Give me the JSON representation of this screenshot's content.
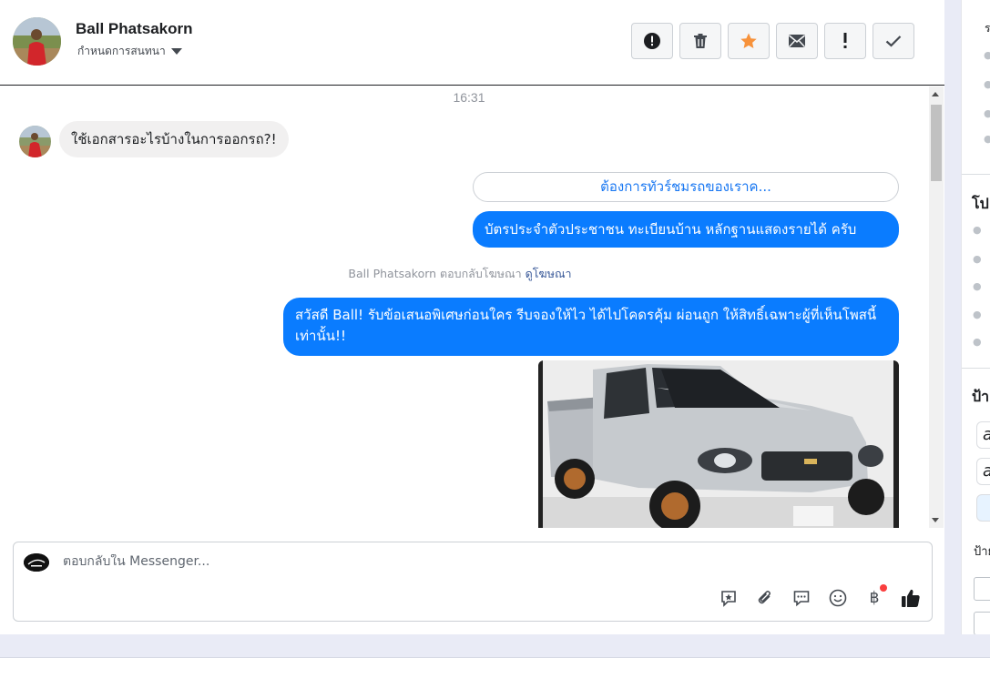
{
  "contact": {
    "name": "Ball Phatsakorn",
    "assign_label": "กำหนดการสนทนา"
  },
  "header_actions": [
    {
      "icon": "alert-circle-icon"
    },
    {
      "icon": "trash-icon"
    },
    {
      "icon": "star-icon"
    },
    {
      "icon": "envelope-icon"
    },
    {
      "icon": "exclamation-icon"
    },
    {
      "icon": "check-icon"
    }
  ],
  "conversation": {
    "timestamp": "16:31",
    "incoming_message": "ใช้เอกสารอะไรบ้างในการออกรถ?!",
    "quick_reply": "ต้องการทัวร์ชมรถของเราค...",
    "outgoing_message_1": "บัตรประจำตัวประชาชน ทะเบียนบ้าน หลักฐานแสดงรายได้ ครับ",
    "ad_note_prefix": "Ball Phatsakorn ตอบกลับโฆษณา",
    "ad_note_link": "ดูโฆษณา",
    "outgoing_message_2": "สวัสดี Ball! รับข้อเสนอพิเศษก่อนใคร รีบจองให้ไว ได้ไปโคดรคุ้ม ผ่อนถูก ให้สิทธิ์เฉพาะผู้ที่เห็นโพสนี้เท่านั้น!!"
  },
  "composer": {
    "placeholder": "ตอบกลับใน Messenger...",
    "tools": [
      "saved-reply-icon",
      "attachment-icon",
      "chat-bubble-icon",
      "emoji-icon",
      "baht-payment-icon",
      "thumbs-up-icon"
    ],
    "baht_symbol": "฿"
  },
  "sidebar": {
    "letter_top": "ร",
    "heading_1": "โป",
    "heading_2": "ป้า",
    "label_small": "ป้าย",
    "pill_1": "a",
    "pill_2": "a"
  },
  "colors": {
    "accent": "#0a7cff",
    "link": "#1877f2",
    "incoming_bubble": "#f1f0f0",
    "star": "#f7923b"
  }
}
